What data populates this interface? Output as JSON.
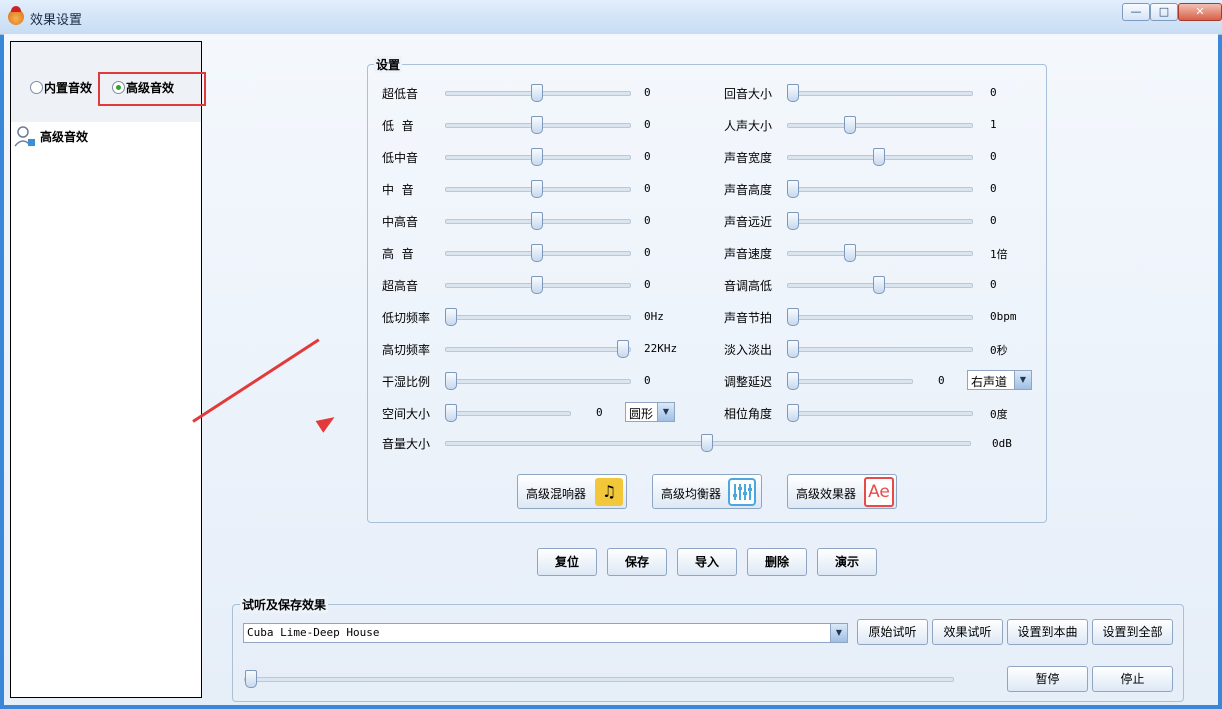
{
  "window": {
    "title": "效果设置",
    "buttons": [
      "—",
      "□",
      "✕"
    ]
  },
  "left_panel": {
    "radio_builtin": "内置音效",
    "radio_advanced": "高级音效",
    "selected": "高级音效",
    "item_label": "高级音效"
  },
  "settings": {
    "group_title": "设置",
    "left_sliders": [
      {
        "label": "超低音",
        "value": "0",
        "level": 0.5
      },
      {
        "label": "低  音",
        "value": "0",
        "level": 0.5
      },
      {
        "label": "低中音",
        "value": "0",
        "level": 0.5
      },
      {
        "label": "中  音",
        "value": "0",
        "level": 0.5
      },
      {
        "label": "中高音",
        "value": "0",
        "level": 0.5
      },
      {
        "label": "高  音",
        "value": "0",
        "level": 0.5
      },
      {
        "label": "超高音",
        "value": "0",
        "level": 0.5
      },
      {
        "label": "低切频率",
        "value": "0Hz",
        "level": 0
      },
      {
        "label": "高切频率",
        "value": "22KHz",
        "level": 1
      },
      {
        "label": "干湿比例",
        "value": "0",
        "level": 0
      },
      {
        "label": "空间大小",
        "value": "0",
        "level": 0
      }
    ],
    "space_combo": "圆形",
    "right_sliders": [
      {
        "label": "回音大小",
        "value": "0",
        "level": 0
      },
      {
        "label": "人声大小",
        "value": "1",
        "level": 0.33
      },
      {
        "label": "声音宽度",
        "value": "0",
        "level": 0.5
      },
      {
        "label": "声音高度",
        "value": "0",
        "level": 0
      },
      {
        "label": "声音远近",
        "value": "0",
        "level": 0
      },
      {
        "label": "声音速度",
        "value": "1倍",
        "level": 0.33
      },
      {
        "label": "音调高低",
        "value": "0",
        "level": 0.5
      },
      {
        "label": "声音节拍",
        "value": "0bpm",
        "level": 0
      },
      {
        "label": "淡入淡出",
        "value": "0秒",
        "level": 0
      },
      {
        "label": "调整延迟",
        "value": "0",
        "level": 0
      },
      {
        "label": "相位角度",
        "value": "0度",
        "level": 0
      }
    ],
    "delay_combo": "右声道",
    "volume": {
      "label": "音量大小",
      "value": "0dB",
      "level": 0.5
    },
    "fx_buttons": [
      {
        "label": "高级混响器",
        "icon": "music-note-icon",
        "color": "#f2c73a"
      },
      {
        "label": "高级均衡器",
        "icon": "equalizer-icon",
        "color": "#4aa8de"
      },
      {
        "label": "高级效果器",
        "icon": "ae-icon",
        "icon_text": "Ae",
        "color": "#e84a4a"
      }
    ]
  },
  "actions": [
    "复位",
    "保存",
    "导入",
    "删除",
    "演示"
  ],
  "preview": {
    "group_title": "试听及保存效果",
    "song": "Cuba Lime-Deep House",
    "buttons": [
      "原始试听",
      "效果试听",
      "设置到本曲",
      "设置到全部"
    ],
    "progress": 0,
    "pause": "暂停",
    "stop": "停止"
  }
}
